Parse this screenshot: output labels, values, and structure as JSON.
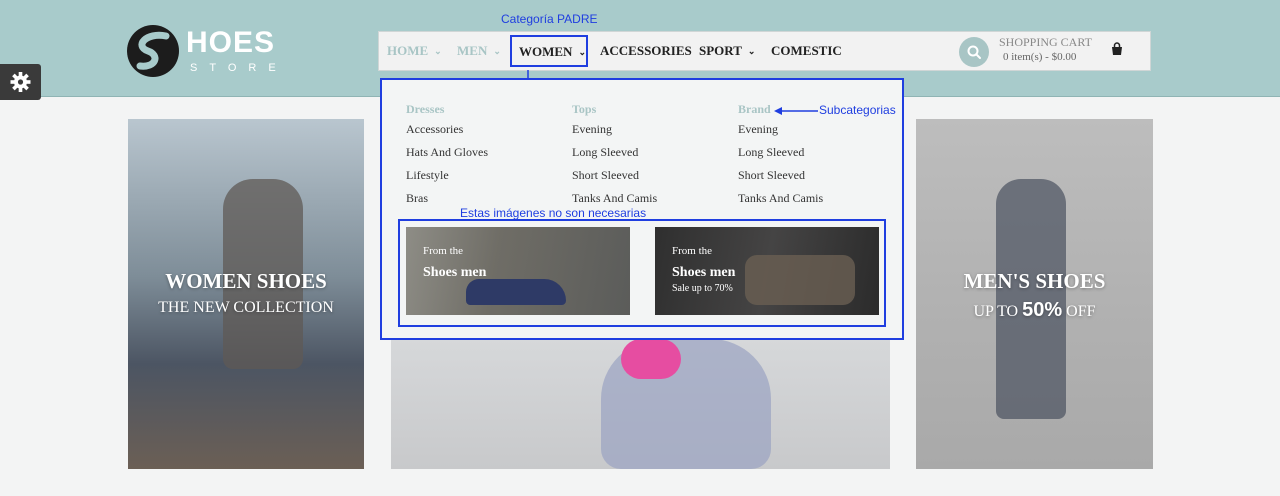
{
  "logo": {
    "main": "HOES",
    "sub": "STORE"
  },
  "nav": {
    "home": "HOME",
    "men": "MEN",
    "women": "WOMEN",
    "accessories": "ACCESSORIES",
    "sport": "SPORT",
    "comestic": "COMESTIC"
  },
  "cart": {
    "title": "SHOPPING CART",
    "items": "0 item(s) - $0.00"
  },
  "annotations": {
    "parent_category": "Categoría PADRE",
    "subcategories": "Subcategorias",
    "images_not_needed": "Estas imágenes no son necesarias"
  },
  "mega_menu": {
    "columns": [
      {
        "heading": "Dresses",
        "links": [
          "Accessories",
          "Hats And Gloves",
          "Lifestyle",
          "Bras"
        ]
      },
      {
        "heading": "Tops",
        "links": [
          "Evening",
          "Long Sleeved",
          "Short Sleeved",
          "Tanks And Camis"
        ]
      },
      {
        "heading": "Brand",
        "links": [
          "Evening",
          "Long Sleeved",
          "Short Sleeved",
          "Tanks And Camis"
        ]
      }
    ],
    "promos": [
      {
        "small": "From the",
        "big": "Shoes men",
        "tag": ""
      },
      {
        "small": "From the",
        "big": "Shoes men",
        "tag": "Sale up to 70%"
      }
    ]
  },
  "banners": {
    "left": {
      "title": "WOMEN SHOES",
      "subtitle": "THE NEW COLLECTION"
    },
    "right": {
      "title": "MEN'S SHOES",
      "sub_prefix": "UP TO",
      "sub_big": "50%",
      "sub_suffix": "OFF"
    }
  },
  "colors": {
    "topbar": "#a8cbcb",
    "accent": "#a9c5c5",
    "annotation": "#1f3ee0"
  },
  "icons": {
    "search": "search-icon",
    "cart": "shopping-bag-icon",
    "settings": "gear-icon",
    "nav_dropdown": "chevron-down-icon"
  }
}
